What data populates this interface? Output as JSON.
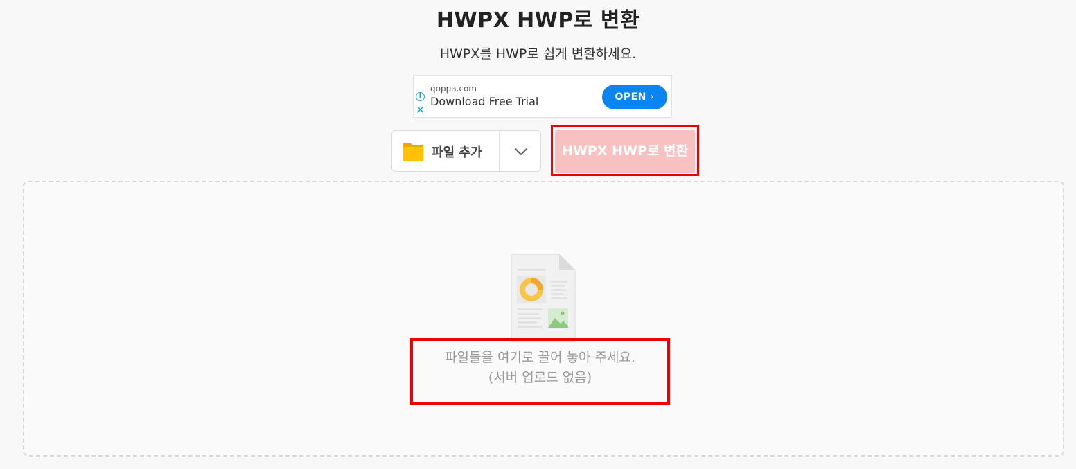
{
  "header": {
    "title": "HWPX HWP로 변환",
    "subtitle": "HWPX를 HWP로 쉽게 변환하세요."
  },
  "ad": {
    "domain": "qoppa.com",
    "headline": "Download Free Trial",
    "open_label": "OPEN ›",
    "info_icon": "i",
    "close_icon": "✕",
    "accent_color": "#0a84f0"
  },
  "toolbar": {
    "add_file_label": "파일 추가",
    "convert_label": "HWPX HWP로 변환",
    "folder_icon": "folder-icon",
    "dropdown_icon": "chevron-down-icon"
  },
  "dropzone": {
    "line1": "파일들을 여기로 끌어 놓아 주세요.",
    "line2": "(서버 업로드 없음)"
  },
  "colors": {
    "convert_button_bg": "#f8c1c1",
    "highlight_box": "#ee0000",
    "folder": "#ffc107"
  }
}
